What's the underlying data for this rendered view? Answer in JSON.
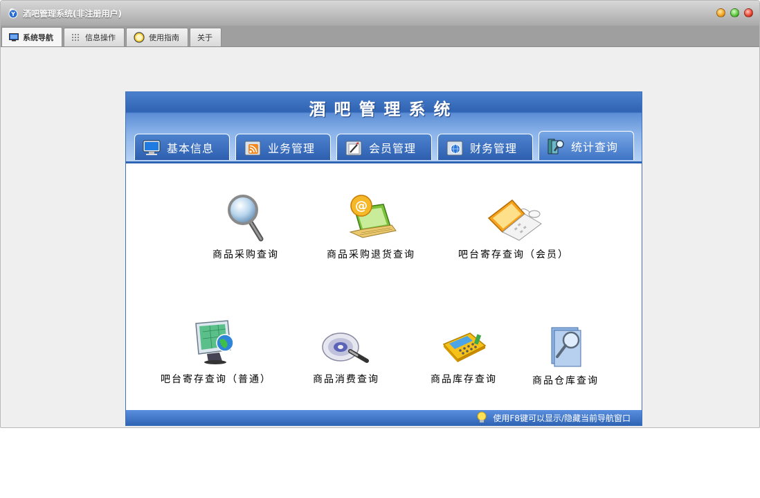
{
  "window": {
    "title": "酒吧管理系统(非注册用户)",
    "icon": "app-logo-icon"
  },
  "tabs": [
    {
      "label": "系统导航",
      "icon": "monitor-icon",
      "active": true
    },
    {
      "label": "信息操作",
      "icon": "grid-icon",
      "active": false
    },
    {
      "label": "使用指南",
      "icon": "compass-icon",
      "active": false
    },
    {
      "label": "关于",
      "icon": "",
      "active": false
    }
  ],
  "panel": {
    "title": "酒吧管理系统",
    "nav_tabs": [
      {
        "label": "基本信息",
        "icon": "monitor-icon",
        "active": false
      },
      {
        "label": "业务管理",
        "icon": "rss-folder-icon",
        "active": false
      },
      {
        "label": "会员管理",
        "icon": "pen-folder-icon",
        "active": false
      },
      {
        "label": "财务管理",
        "icon": "globe-folder-icon",
        "active": false
      },
      {
        "label": "统计查询",
        "icon": "magnifier-book-icon",
        "active": true
      }
    ],
    "items": [
      {
        "label": "商品采购查询",
        "icon": "magnifier-icon"
      },
      {
        "label": "商品采购退货查询",
        "icon": "email-laptop-icon"
      },
      {
        "label": "吧台寄存查询（会员）",
        "icon": "laptop-icon"
      },
      {
        "label": "吧台寄存查询（普通）",
        "icon": "globe-monitor-icon"
      },
      {
        "label": "商品消费查询",
        "icon": "disc-search-icon"
      },
      {
        "label": "商品库存查询",
        "icon": "calculator-icon"
      },
      {
        "label": "商品仓库查询",
        "icon": "document-search-icon"
      }
    ],
    "footer_hint": "使用F8键可以显示/隐藏当前导航窗口",
    "footer_icon": "lightbulb-icon"
  },
  "colors": {
    "panel_blue": "#2f63b3",
    "light_blue": "#8db5ea",
    "tabbar_gray": "#9f9f9f"
  }
}
